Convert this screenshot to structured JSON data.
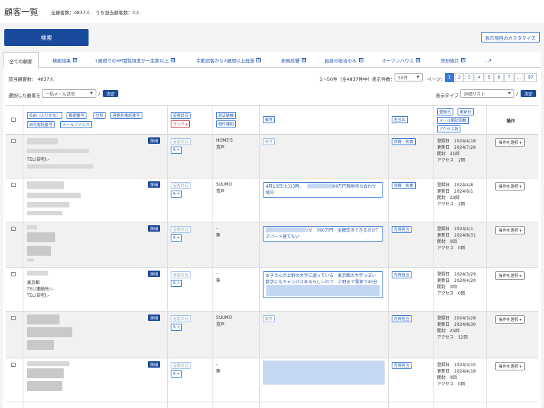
{
  "header": {
    "title": "顧客一覧",
    "total_customers": "全顧客数：4837人",
    "my_customers": "うち担当顧客数：0人"
  },
  "toolbar": {
    "search_label": "検索",
    "customize_label": "表示項目のカスタマイズ"
  },
  "tabs": [
    {
      "label": "全ての顧客",
      "active": true
    },
    {
      "label": "検索結果"
    },
    {
      "label": "1週間でのHP閲覧頻度が一定数以上"
    },
    {
      "label": "手動追客から2週間以上経過"
    },
    {
      "label": "新規反響"
    },
    {
      "label": "自身の担当のみ"
    },
    {
      "label": "オープンハウス"
    },
    {
      "label": "売却検討"
    },
    {
      "label": "…▾"
    }
  ],
  "list": {
    "count_label": "該当顧客数： 4837人",
    "range_label": "1〜50件（全4837件中）",
    "per_page_label": "表示件数：",
    "per_page_value": "50件",
    "page_label": "ページ：",
    "pages": [
      "1",
      "2",
      "3",
      "4",
      "5",
      "6",
      "7",
      "…",
      "97"
    ],
    "bulk_label": "選択した顧客を",
    "bulk_value": "一括メール送信",
    "decide_label": "決定",
    "display_type_label": "表示タイプ",
    "display_type_value": "詳細リスト",
    "slash": "/"
  },
  "columns": {
    "name_chips": [
      "名前（ふりがな）",
      "郵便番号",
      "住所",
      "連絡先電話番号",
      "自宅電話番号",
      "メールアドレス"
    ],
    "status_chips": [
      "追客状況",
      "ランク ▴"
    ],
    "source_chips": [
      "来店動機",
      "物件種別"
    ],
    "note_chip": "備考",
    "staff_chip": "担当名",
    "date_chips": [
      "登録日",
      "更新日",
      "メール開封回数",
      "アクセス数"
    ],
    "ops_title": "操作"
  },
  "rows": [
    {
      "detail": "詳細",
      "tel_lines": [
        "TEL(自宅):-"
      ],
      "status": "追客状況",
      "rank": "A +",
      "source": "HOME'S",
      "type": "賃戸",
      "note": "備考",
      "note_dim": true,
      "staff": "西野　彰貴",
      "registered": "登録日　2024/4/18",
      "updated": "更新日　2024/7/26",
      "opened": "開封　21回",
      "access": "アクセス　2回",
      "op": "操作を選択 ▾"
    },
    {
      "detail": "詳細",
      "tel_lines": [],
      "status": "追客状況",
      "rank": "A +",
      "source": "SUUMO",
      "type": "賃戸",
      "note": "4月13日(土)13時、　　　　　　4599万円現地待ち合わせ案内",
      "staff": "西野　彰貴",
      "registered": "登録日　2024/4/8",
      "updated": "更新日　2024/6/1",
      "opened": "開封　23回",
      "access": "アクセス　2回",
      "op": "操作を選択 ▾"
    },
    {
      "detail": "詳細",
      "tel_lines": [],
      "status": "追客状況",
      "rank": "A +",
      "source": "-",
      "type": "無",
      "note": "　　　　　　問い合わせ　780万円　金額交渉できるのか？アパート建てたい",
      "staff": "売買担当",
      "registered": "登録日　2024/4/1",
      "updated": "更新日　2024/8/31",
      "opened": "開封　0回",
      "access": "アクセス　0回",
      "op": "操作を選択 ▾"
    },
    {
      "detail": "詳細",
      "tel_lines": [
        "東京都",
        "TEL(連絡先):-",
        "TEL(自宅):-"
      ],
      "status": "追客状況",
      "rank": "A +",
      "source": "-",
      "type": "無",
      "note": "お子さんが上野の大学に通っている　東京都の大学っぽい　数学にもキャンパスあるらしいので　上野まで電車で45分",
      "staff": "売買担当",
      "registered": "登録日　2024/3/29",
      "updated": "更新日　2024/4/20",
      "opened": "開封　0回",
      "access": "アクセス　0回",
      "op": "操作を選択 ▾"
    },
    {
      "detail": "詳細",
      "tel_lines": [],
      "status": "追客状況",
      "rank": "A +",
      "source": "SUUMO",
      "type": "賃戸",
      "note": "備考",
      "note_dim": true,
      "staff": "売買担当",
      "registered": "登録日　2024/3/28",
      "updated": "更新日　2024/8/30",
      "opened": "開封　25回",
      "access": "アクセス　12回",
      "op": "操作を選択 ▾"
    },
    {
      "detail": "詳細",
      "tel_lines": [],
      "status": "追客状況",
      "rank": "A +",
      "source": "-",
      "type": "無",
      "note": "",
      "staff": "売買担当",
      "registered": "登録日　2024/3/10",
      "updated": "更新日　2024/4/18",
      "opened": "開封　0回",
      "access": "アクセス　0回",
      "op": "操作を選択 ▾"
    }
  ],
  "colors": {
    "primary": "#1a4a9c",
    "link": "#2a5db0",
    "active_page": "#3a7bd5",
    "rank": "#cc3333"
  }
}
